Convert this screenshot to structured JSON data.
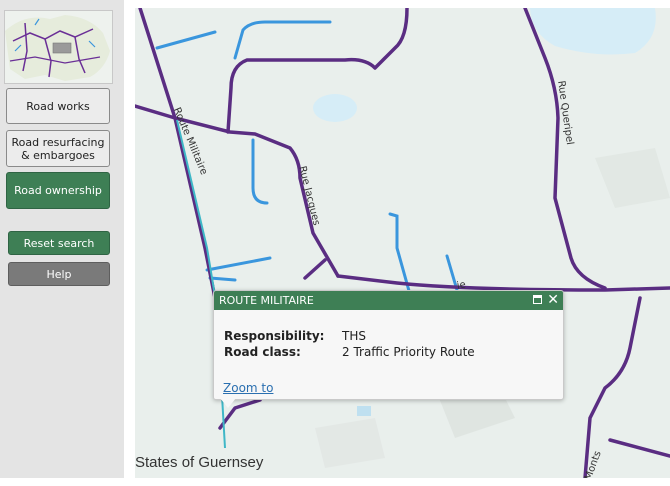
{
  "sidebar": {
    "buttons": {
      "road_works": "Road works",
      "road_resurfacing": "Road resurfacing & embargoes",
      "road_ownership": "Road ownership",
      "reset_search": "Reset search",
      "help": "Help"
    }
  },
  "map": {
    "road_labels": {
      "route_militaire": "Route Militaire",
      "rue_jacques": "Rue Jacques",
      "rue_queripel": "Rue Queripel",
      "monts": "Monts",
      "partial_ie": "ie"
    },
    "attribution": "States of Guernsey",
    "colors": {
      "states_road": "#5a2d82",
      "parish_road": "#3a96dd",
      "selected_road": "#3fb7c7",
      "water": "#d6edf7"
    }
  },
  "popup": {
    "title": "ROUTE MILITAIRE",
    "fields": [
      {
        "key": "Responsibility:",
        "value": "THS"
      },
      {
        "key": "Road class:",
        "value": "2 Traffic Priority Route"
      }
    ],
    "zoom_link": "Zoom to",
    "header_color": "#3e7f55"
  }
}
